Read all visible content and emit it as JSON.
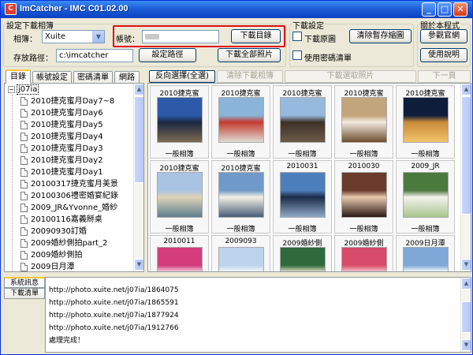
{
  "window": {
    "title": "ImCatcher - IMC C01.02.00",
    "app_icon": "C",
    "min": "_",
    "max": "□",
    "close": "✕"
  },
  "download_settings": {
    "group_title": "設定下載相簿",
    "album_label": "相簿：",
    "album_value": "Xuite",
    "account_label": "帳號：",
    "account_value": "",
    "download_dir_button": "下載目錄",
    "path_label": "存放路徑：",
    "path_value": "c:\\imcatcher",
    "set_path_button": "設定路徑",
    "download_all_button": "下載全部照片"
  },
  "dl_options": {
    "group_title": "下載設定",
    "original_label": "下載原圖",
    "clear_cache_button": "清除暫存縮圖",
    "use_password_label": "使用密碼清單"
  },
  "about": {
    "group_title": "關於本程式",
    "visit_button": "參觀官網",
    "help_button": "使用說明"
  },
  "left_tabs": [
    "目錄",
    "帳號設定",
    "密碼清單",
    "網路"
  ],
  "tree": {
    "root": "j07ia",
    "items": [
      "2010捷克蜜月Day7~8",
      "2010捷克蜜月Day6",
      "2010捷克蜜月Day5",
      "2010捷克蜜月Day4",
      "2010捷克蜜月Day3",
      "2010捷克蜜月Day2",
      "2010捷克蜜月Day1",
      "20100317捷克蜜月美景",
      "20100306禮密婚宴紀錄",
      "2009_JR&Yvonne_婚紗",
      "20100116嘉義掰桌",
      "20090930訂婚",
      "2009婚紗側拍part_2",
      "2009婚紗側拍",
      "2009日月潭"
    ]
  },
  "grid_toolbar": {
    "invert": "反向選擇(全選)",
    "clear": "清除下載相簿",
    "download_selected": "下載選取照片",
    "next_page": "下一頁"
  },
  "photos": [
    {
      "caption": "2010捷克蜜",
      "sub": "一般相簿",
      "colors": [
        "#2d5aa8",
        "#1b2740",
        "#7d6a52"
      ]
    },
    {
      "caption": "2010捷克蜜",
      "sub": "一般相簿",
      "colors": [
        "#8ab4d8",
        "#c43a2f",
        "#dedad2"
      ]
    },
    {
      "caption": "2010捷克蜜",
      "sub": "一般相簿",
      "colors": [
        "#96b9de",
        "#3d3128",
        "#6b5a48"
      ]
    },
    {
      "caption": "2010捷克蜜",
      "sub": "一般相簿",
      "colors": [
        "#c2a57a",
        "#f3eadf",
        "#6e4d2d"
      ]
    },
    {
      "caption": "2010捷克蜜",
      "sub": "一般相簿",
      "colors": [
        "#0e1d3a",
        "#c88a3a",
        "#f1c46a"
      ]
    },
    {
      "caption": "2010捷克蜜",
      "sub": "一般相簿",
      "colors": [
        "#a9c3e3",
        "#e0d4b8",
        "#5e7d8f"
      ]
    },
    {
      "caption": "2010捷克蜜",
      "sub": "一般相簿",
      "colors": [
        "#6f99c9",
        "#f3efe5",
        "#4a5e78"
      ]
    },
    {
      "caption": "2010031",
      "sub": "一般相簿",
      "colors": [
        "#4d7fbd",
        "#1b2c48",
        "#8fa8c6"
      ]
    },
    {
      "caption": "2010030",
      "sub": "一般相簿",
      "colors": [
        "#6b3b2e",
        "#e8c8ae",
        "#2b1a16"
      ]
    },
    {
      "caption": "2009_JR",
      "sub": "一般相簿",
      "colors": [
        "#4b7a3e",
        "#f4f2ee",
        "#a9c58c"
      ]
    },
    {
      "caption": "2010011",
      "sub": "",
      "colors": [
        "#d43c7c",
        "#f5d7e2",
        "#7a2d4a"
      ]
    },
    {
      "caption": "2009093",
      "sub": "",
      "colors": [
        "#bcd4ec",
        "#f7f7f7",
        "#6b8fae"
      ]
    },
    {
      "caption": "2009婚紗側",
      "sub": "",
      "colors": [
        "#2f6a3c",
        "#e6e0cc",
        "#8aa05a"
      ]
    },
    {
      "caption": "2009婚紗側",
      "sub": "",
      "colors": [
        "#d94b6a",
        "#f2c9d2",
        "#3d6a3a"
      ]
    },
    {
      "caption": "2009日月潭",
      "sub": "",
      "colors": [
        "#7fa8d6",
        "#ffffff",
        "#4a6d9a"
      ]
    }
  ],
  "log_tabs": [
    "系統訊息",
    "下載清單"
  ],
  "log_lines": [
    "http://photo.xuite.net/j07ia/1864075",
    "http://photo.xuite.net/j07ia/1865591",
    "http://photo.xuite.net/j07ia/1877924",
    "http://photo.xuite.net/j07ia/1912766",
    "處理完成！"
  ],
  "scroll_icons": {
    "up": "▲",
    "down": "▼",
    "combo": "▼"
  }
}
